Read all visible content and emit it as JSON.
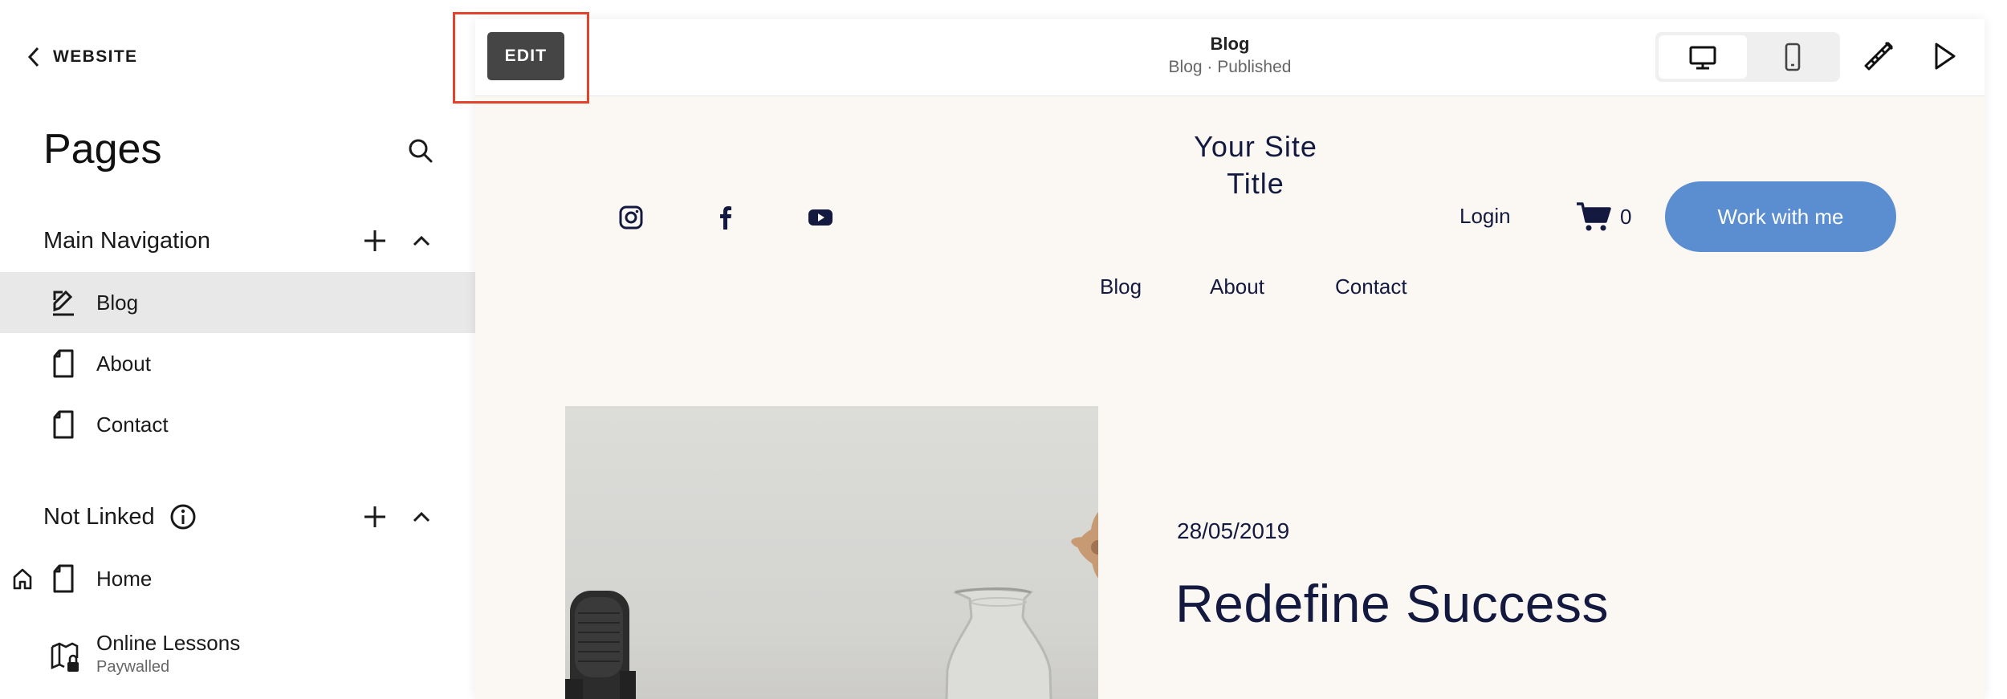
{
  "sidebar": {
    "back_label": "WEBSITE",
    "title": "Pages",
    "sections": [
      {
        "label": "Main Navigation",
        "items": [
          {
            "label": "Blog",
            "icon": "blog-page-icon",
            "active": true
          },
          {
            "label": "About",
            "icon": "page-icon"
          },
          {
            "label": "Contact",
            "icon": "page-icon"
          }
        ]
      },
      {
        "label": "Not Linked",
        "items": [
          {
            "label": "Home",
            "icon": "page-icon",
            "badge": "home-icon"
          },
          {
            "label": "Online Lessons",
            "sublabel": "Paywalled",
            "icon": "locked-pages-icon"
          }
        ]
      }
    ]
  },
  "toolbar": {
    "edit_label": "EDIT",
    "page_title": "Blog",
    "page_status": "Blog · Published",
    "device_options": [
      "desktop-icon",
      "mobile-icon"
    ],
    "selected_device": "desktop",
    "tools": [
      "site-styles-icon",
      "preview-play-icon"
    ]
  },
  "site": {
    "title_line1": "Your Site",
    "title_line2": "Title",
    "social_icons": [
      "instagram-icon",
      "facebook-icon",
      "youtube-icon"
    ],
    "login_label": "Login",
    "cart_count": "0",
    "cta_label": "Work with me",
    "nav": [
      "Blog",
      "About",
      "Contact"
    ]
  },
  "post": {
    "date": "28/05/2019",
    "title": "Redefine Success"
  },
  "colors": {
    "accent_cta": "#5b8dd1",
    "site_text": "#141a3f",
    "site_bg": "#fbf8f4",
    "edit_highlight": "#e2432a"
  }
}
